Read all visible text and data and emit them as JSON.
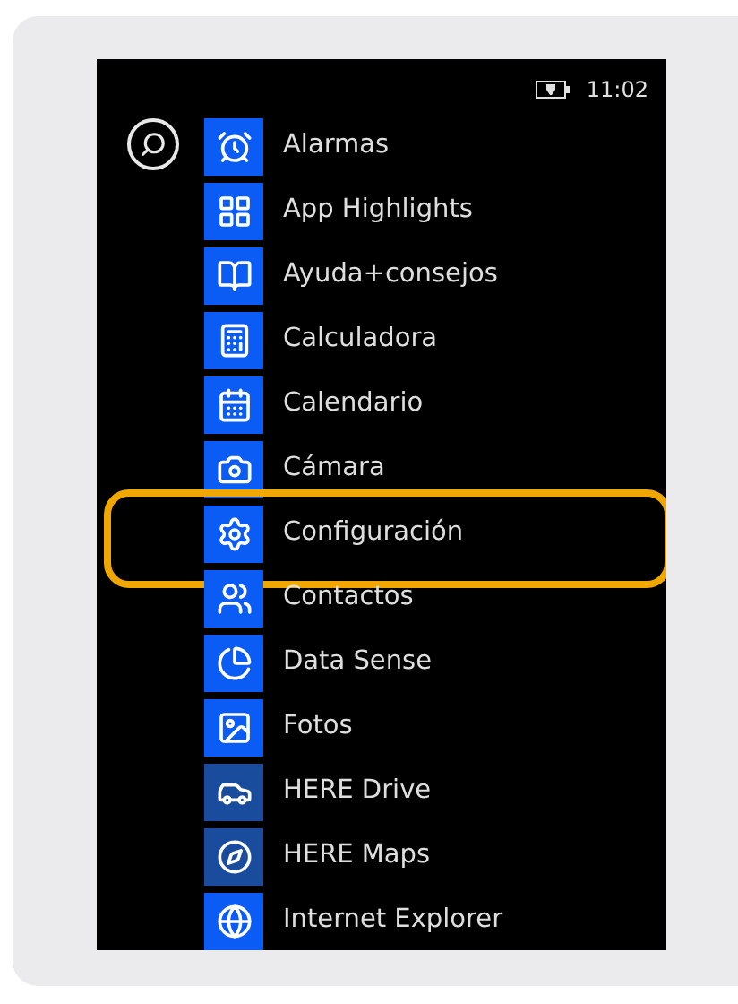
{
  "status_bar": {
    "time": "11:02"
  },
  "apps": [
    {
      "label": "Alarmas",
      "color": "#0a5cf5",
      "highlighted": false
    },
    {
      "label": "App Highlights",
      "color": "#0a5cf5",
      "highlighted": false
    },
    {
      "label": "Ayuda+consejos",
      "color": "#0a5cf5",
      "highlighted": false
    },
    {
      "label": "Calculadora",
      "color": "#0a5cf5",
      "highlighted": false
    },
    {
      "label": "Calendario",
      "color": "#0a5cf5",
      "highlighted": false
    },
    {
      "label": "Cámara",
      "color": "#0a5cf5",
      "highlighted": false
    },
    {
      "label": "Configuración",
      "color": "#0a5cf5",
      "highlighted": true
    },
    {
      "label": "Contactos",
      "color": "#0a5cf5",
      "highlighted": false
    },
    {
      "label": "Data Sense",
      "color": "#0a5cf5",
      "highlighted": false
    },
    {
      "label": "Fotos",
      "color": "#0a5cf5",
      "highlighted": false
    },
    {
      "label": "HERE Drive",
      "color": "#1a4c9e",
      "highlighted": false
    },
    {
      "label": "HERE Maps",
      "color": "#1a4c9e",
      "highlighted": false
    },
    {
      "label": "Internet Explorer",
      "color": "#0a5cf5",
      "highlighted": false
    }
  ]
}
